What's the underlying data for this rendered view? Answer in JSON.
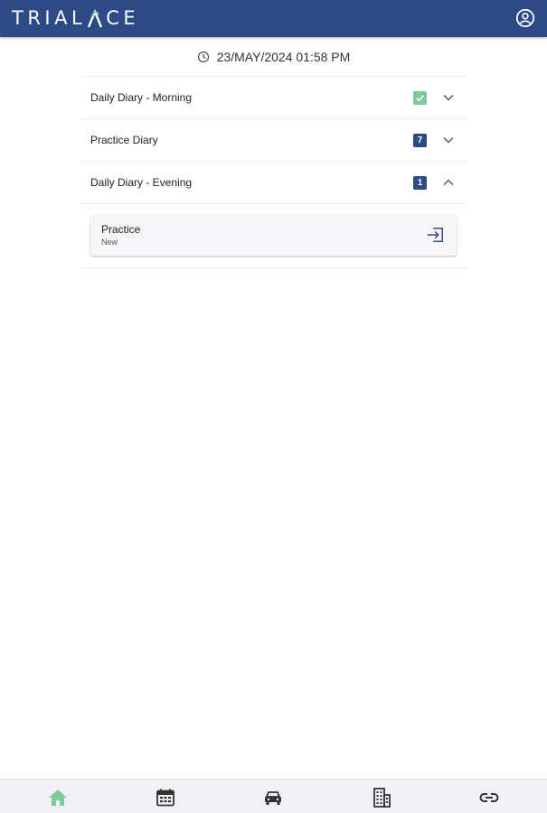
{
  "app": {
    "brand": "TRIALPACE",
    "brand_left": "TRIAL",
    "brand_right": "CE",
    "colors": {
      "primary": "#2c4a86",
      "success": "#7dcb98",
      "nav_active": "#7dcb98",
      "nav_inactive": "#333333"
    }
  },
  "header": {
    "user_icon": "account-circle-icon"
  },
  "timestamp": {
    "icon": "clock-icon",
    "text": "23/MAY/2024 01:58 PM"
  },
  "diaries": [
    {
      "label": "Daily Diary - Morning",
      "badge": "",
      "badge_type": "check",
      "expanded": false
    },
    {
      "label": "Practice Diary",
      "badge": "7",
      "badge_type": "count",
      "expanded": false
    },
    {
      "label": "Daily Diary - Evening",
      "badge": "1",
      "badge_type": "count",
      "expanded": true
    }
  ],
  "expanded_card": {
    "title": "Practice",
    "status": "New",
    "icon": "enter-icon"
  },
  "bottom_nav": [
    {
      "name": "home",
      "icon": "home-icon",
      "active": true
    },
    {
      "name": "calendar",
      "icon": "calendar-icon",
      "active": false
    },
    {
      "name": "car",
      "icon": "car-icon",
      "active": false
    },
    {
      "name": "building",
      "icon": "building-icon",
      "active": false
    },
    {
      "name": "link",
      "icon": "link-icon",
      "active": false
    }
  ]
}
